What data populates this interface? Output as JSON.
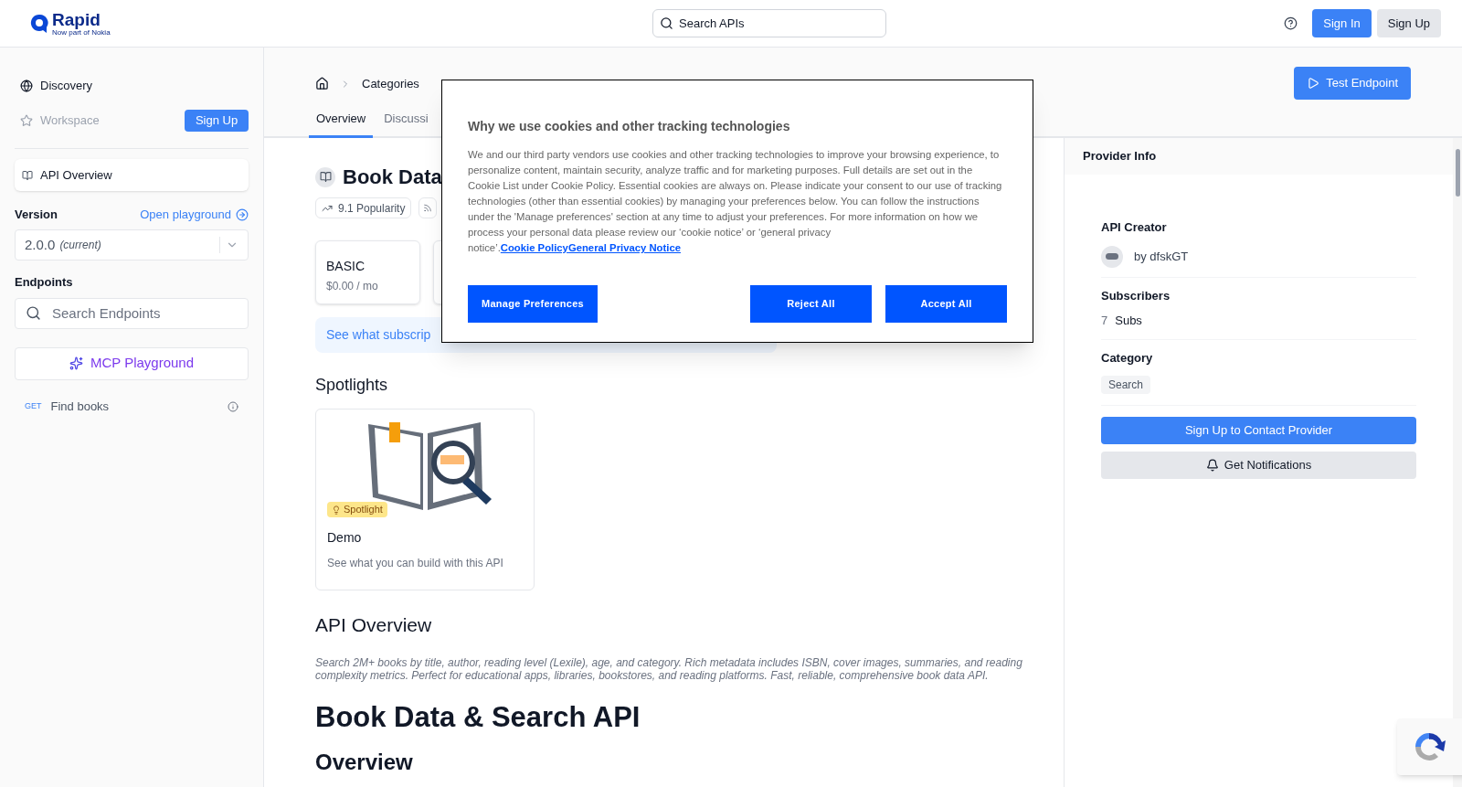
{
  "header": {
    "logo": "Rapid",
    "logo_tagline": "Now part of Nokia",
    "search": {
      "placeholder": "Search APIs"
    },
    "buttons": [
      {
        "label": "Sign In",
        "kind": "primary"
      },
      {
        "label": "Sign Up",
        "kind": "secondary"
      }
    ]
  },
  "sidebar": {
    "nav": [
      {
        "label": "Discovery",
        "disabled": false
      },
      {
        "label": "Workspace",
        "disabled": true
      }
    ],
    "signup_button": "Sign Up",
    "overview_item": {
      "label": "API Overview",
      "selected": true
    },
    "version": {
      "label": "Version",
      "link": "Open playground",
      "value": "2.0.0",
      "note": "(current)"
    },
    "endpoints": {
      "label": "Endpoints",
      "search": {
        "placeholder": "Search Endpoints"
      },
      "mcp_button": "MCP Playground",
      "items": [
        {
          "method": "GET",
          "name": "Find books"
        }
      ]
    }
  },
  "breadcrumbs": [
    "Categories"
  ],
  "tabs": [
    {
      "label": "Overview",
      "selected": true
    },
    {
      "label": "Discussi",
      "selected": false
    }
  ],
  "test_button": "Test Endpoint",
  "api": {
    "title": "Book Data",
    "stats": [
      "9.1 Popularity"
    ],
    "plans": [
      {
        "name": "BASIC",
        "price": "$0.00 / mo"
      }
    ],
    "plans_banner": "See what subscrip",
    "spotlights_heading": "Spotlights",
    "spotlights": [
      {
        "badge": "Spotlight",
        "title": "Demo",
        "description": "See what you can build with this API"
      }
    ],
    "overview_heading": "API Overview",
    "description": "Search 2M+ books by title, author, reading level (Lexile), age, and category. Rich metadata includes ISBN, cover images, summaries, and reading complexity metrics. Perfect for educational apps, libraries, bookstores, and reading platforms. Fast, reliable, comprehensive book data API.",
    "h1": "Book Data & Search API",
    "h2": "Overview"
  },
  "provider": {
    "header": "Provider Info",
    "creator_label": "API Creator",
    "creator": "by dfskGT",
    "subscribers_label": "Subscribers",
    "subscribers_count": "7",
    "subscribers_unit": "Subs",
    "category_label": "Category",
    "category": "Search",
    "contact_button": "Sign Up to Contact Provider",
    "notify_button": "Get Notifications"
  },
  "cookie_dialog": {
    "title": "Why we use cookies and other tracking technologies",
    "body": "We and our third party vendors use cookies and other tracking technologies to improve your browsing experience, to personalize content, maintain security, analyze traffic and for marketing purposes. Full details are set out in the Cookie List under Cookie Policy. Essential cookies are always on. Please indicate your consent to our use of tracking technologies (other than essential cookies) by managing your preferences below. You can follow the instructions under the 'Manage preferences' section at any time to adjust your preferences. For more information on how we process your personal data please review our ‘cookie notice’ or ‘general privacy notice’.",
    "links": [
      "Cookie Policy",
      "General Privacy Notice"
    ],
    "buttons": [
      "Manage Preferences",
      "Reject All",
      "Accept All"
    ]
  }
}
